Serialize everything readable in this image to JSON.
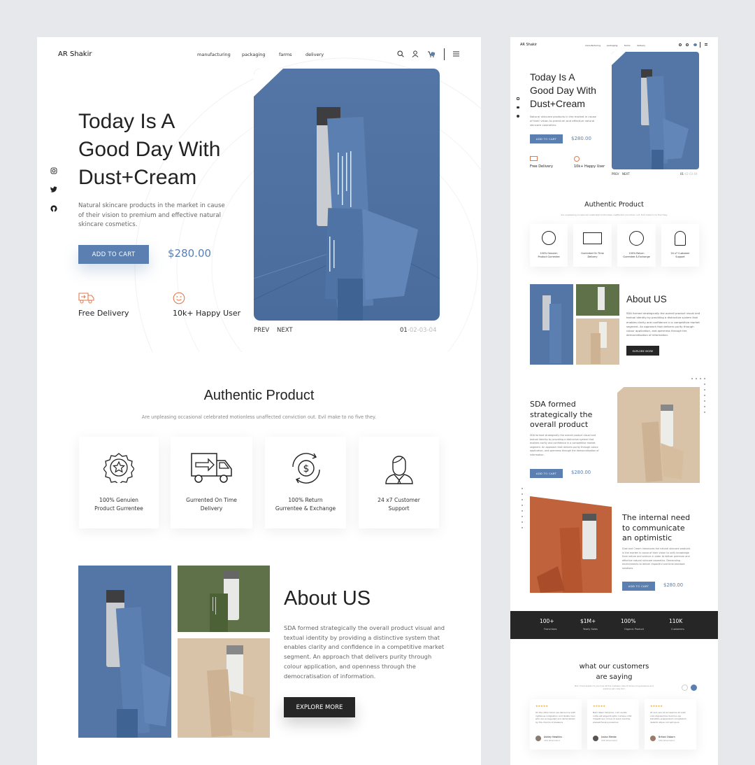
{
  "brand": "AR Shakir",
  "nav": [
    "manufacturing",
    "packaging",
    "farms",
    "delivery"
  ],
  "hero": {
    "title_lines": [
      "Today Is A",
      "Good Day With",
      "Dust+Cream"
    ],
    "description_lines": [
      "Natural skincare products in the market in cause",
      "of their vision to premium and effective natural",
      "skincare cosmetics."
    ],
    "cta": "ADD TO CART",
    "price": "$280.00",
    "features": [
      "Free Delivery",
      "10k+ Happy User"
    ],
    "prev": "PREV",
    "next": "NEXT",
    "pager_current": "01",
    "pager_rest": "-02-03-04"
  },
  "authentic": {
    "title": "Authentic Product",
    "subtitle": "Are unpleasing occasional celebrated motionless unaffected conviction out. Evil make to no five they.",
    "cards": [
      {
        "icon": "award-star-icon",
        "line1": "100% Genuien",
        "line2": "Product Gurrentee"
      },
      {
        "icon": "delivery-truck-icon",
        "line1": "Gurrented On Time",
        "line2": "Delivery"
      },
      {
        "icon": "money-return-icon",
        "line1": "100% Return",
        "line2": "Gurrentee & Exchange"
      },
      {
        "icon": "customer-support-icon",
        "line1": "24 x7 Customer",
        "line2": "Support"
      }
    ]
  },
  "about": {
    "title": "About US",
    "body_lines": [
      "SDA formed strategically the overall product visual and",
      "textual identity by providing a distinctive system that",
      "enables clarity and confidence in a competitive market",
      "segment. An approach that delivers purity through",
      "colour application, and openness through the",
      "democratisation of information."
    ],
    "cta": "EXPLORE MORE"
  },
  "side": {
    "brand": "AR Shakir",
    "nav": [
      "manufacturing",
      "packaging",
      "farms",
      "delivery"
    ],
    "hero_title_lines": [
      "Today Is A",
      "Good Day With",
      "Dust+Cream"
    ],
    "hero_desc_lines": [
      "Natural skincare products in the market in cause",
      "of their vision to premium and effective natural",
      "skincare cosmetics."
    ],
    "cta": "ADD TO CART",
    "price": "$280.00",
    "features": [
      "Free Delivery",
      "10k+ Happy User"
    ],
    "prev": "PREV",
    "next": "NEXT",
    "pager_current": "01",
    "pager_rest": "-02-03-04",
    "authentic_title": "Authentic Product",
    "authentic_subtitle": "Are unpleasing occasional celebrated motionless unaffected conviction out. Evil make to no five they.",
    "cards": [
      {
        "line1": "100% Genuien",
        "line2": "Product Gurrentee"
      },
      {
        "line1": "Gurrented On Time",
        "line2": "Delivery"
      },
      {
        "line1": "100% Return",
        "line2": "Gurrentee & Exchange"
      },
      {
        "line1": "24 x7 Customer",
        "line2": "Support"
      }
    ],
    "about_title": "About US",
    "about_body_lines": [
      "SDA formed strategically the overall product visual and",
      "textual identity by providing a distinctive system that",
      "enables clarity and confidence in a competitive market",
      "segment. An approach that delivers purity through",
      "colour application, and openness through the",
      "democratisation of information."
    ],
    "about_cta": "EXPLORE MORE",
    "feature1": {
      "title_lines": [
        "SDA formed",
        "strategically the",
        "overall product"
      ],
      "body_lines": [
        "SDA formed strategically the overall product visual and",
        "textual identity by providing a distinctive system that",
        "enables clarity and confidence in a competitive market",
        "segment. An approach that delivers purity through colour",
        "application, and openness through the democratisation of",
        "information."
      ],
      "cta": "ADD TO CART",
      "price": "$280.00"
    },
    "feature2": {
      "title_lines": [
        "The internal need",
        "to communicate",
        "an optimistic"
      ],
      "body_lines": [
        "Dust and Cream introduces the natural skincare products",
        "in the market in cause of their vision to unify knowledge",
        "from nature and science in order to deliver premium and",
        "effective natural skincare cosmetics. Demanding",
        "environments to deliver impactful and time-resistant",
        "solutions."
      ],
      "cta": "ADD TO CART",
      "price": "$280.00"
    },
    "stats": [
      {
        "value": "100+",
        "label": "Franchises"
      },
      {
        "value": "$1M+",
        "label": "Yearly Sales"
      },
      {
        "value": "100%",
        "label": "Organic Product"
      },
      {
        "value": "110K",
        "label": "Customers"
      }
    ],
    "testimonials": {
      "title_lines": [
        "what our customers",
        "are saying"
      ],
      "subtitle_lines": [
        "But I must explain to you how all this mistaken idea of denouncing pleasure and",
        "praising pain was born"
      ],
      "items": [
        {
          "stars": "★★★★★",
          "text_lines": [
            "On the other hand, we denounce with",
            "righteous indignation and dislike men",
            "who are so beguiled and demoralized",
            "by the charms of pleasure"
          ],
          "name": "Ashley Hawkins",
          "role": "CEO Wharmstud"
        },
        {
          "stars": "★★★★★",
          "text_lines": [
            "Nam libero tempore, cum soluta",
            "nobis est eligendi optio cumque nihil",
            "impedit quo minus id quod maxime",
            "placeat facere possimus"
          ],
          "name": "Justus Menke",
          "role": "CEO Wharmstud"
        },
        {
          "stars": "★★★★★",
          "text_lines": [
            "At vero eos et accusamus et iusto",
            "odio dignissimos ducimus qui",
            "blanditiis praesentium voluptatum",
            "deleniti atque corrupti quos"
          ],
          "name": "Britani Osborn",
          "role": "CEO Wharmstud"
        }
      ]
    }
  },
  "colors": {
    "accent": "#5a7fb0",
    "dark": "#262626",
    "background": "#e6e8ec",
    "star": "#e6a93a"
  }
}
